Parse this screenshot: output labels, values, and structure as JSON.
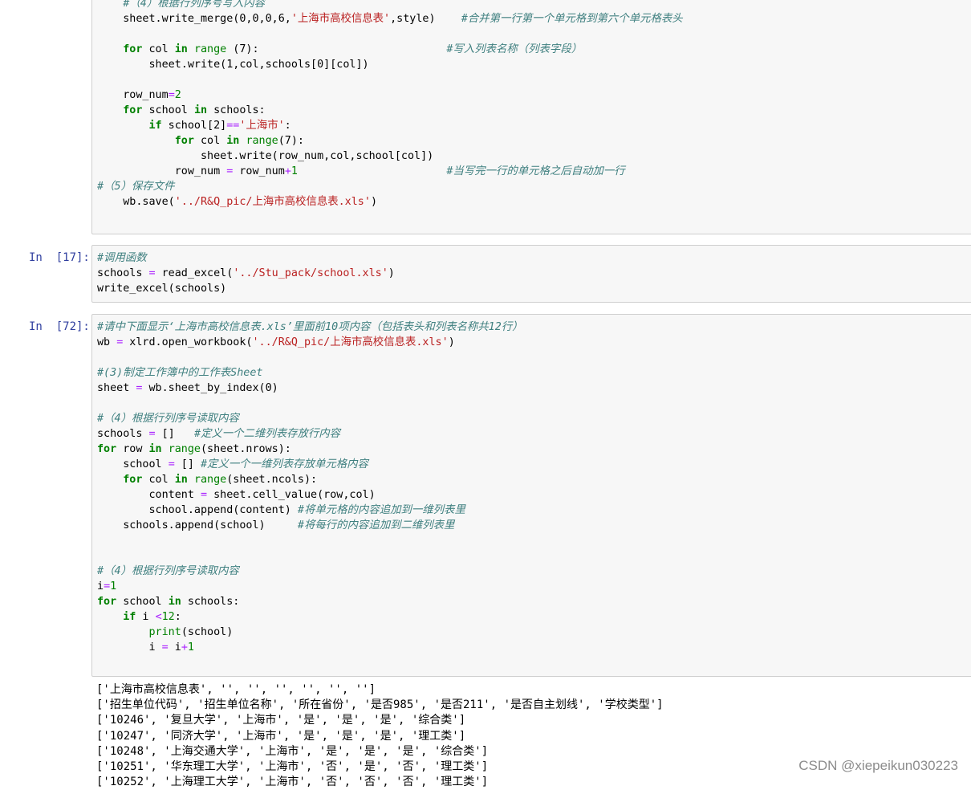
{
  "cells": [
    {
      "prompt": "",
      "lines": [
        [
          {
            "t": "    "
          },
          {
            "t": "#（4）根据行列序号写入内容",
            "c": "cm"
          }
        ],
        [
          {
            "t": "    sheet.write_merge(0,0,0,6,"
          },
          {
            "t": "'上海市高校信息表'",
            "c": "str"
          },
          {
            "t": ",style)    "
          },
          {
            "t": "#合并第一行第一个单元格到第六个单元格表头",
            "c": "cm"
          }
        ],
        [
          {
            "t": ""
          }
        ],
        [
          {
            "t": "    "
          },
          {
            "t": "for",
            "c": "kw"
          },
          {
            "t": " col "
          },
          {
            "t": "in",
            "c": "kw"
          },
          {
            "t": " "
          },
          {
            "t": "range",
            "c": "bi"
          },
          {
            "t": " (7):                             "
          },
          {
            "t": "#写入列表名称（列表字段）",
            "c": "cm"
          }
        ],
        [
          {
            "t": "        sheet.write(1,col,schools[0][col])"
          }
        ],
        [
          {
            "t": ""
          }
        ],
        [
          {
            "t": "    row_num"
          },
          {
            "t": "=",
            "c": "op"
          },
          {
            "t": "2",
            "c": "num"
          }
        ],
        [
          {
            "t": "    "
          },
          {
            "t": "for",
            "c": "kw"
          },
          {
            "t": " school "
          },
          {
            "t": "in",
            "c": "kw"
          },
          {
            "t": " schools:"
          }
        ],
        [
          {
            "t": "        "
          },
          {
            "t": "if",
            "c": "kw"
          },
          {
            "t": " school[2]"
          },
          {
            "t": "==",
            "c": "op"
          },
          {
            "t": "'上海市'",
            "c": "str"
          },
          {
            "t": ":"
          }
        ],
        [
          {
            "t": "            "
          },
          {
            "t": "for",
            "c": "kw"
          },
          {
            "t": " col "
          },
          {
            "t": "in",
            "c": "kw"
          },
          {
            "t": " "
          },
          {
            "t": "range",
            "c": "bi"
          },
          {
            "t": "(7):"
          }
        ],
        [
          {
            "t": "                sheet.write(row_num,col,school[col])"
          }
        ],
        [
          {
            "t": "            row_num "
          },
          {
            "t": "=",
            "c": "op"
          },
          {
            "t": " row_num"
          },
          {
            "t": "+",
            "c": "op"
          },
          {
            "t": "1",
            "c": "num"
          },
          {
            "t": "                       "
          },
          {
            "t": "#当写完一行的单元格之后自动加一行",
            "c": "cm"
          }
        ],
        [
          {
            "t": "#（5）保存文件",
            "c": "cm"
          }
        ],
        [
          {
            "t": "    wb.save("
          },
          {
            "t": "'../R&Q_pic/上海市高校信息表.xls'",
            "c": "str"
          },
          {
            "t": ")"
          }
        ]
      ]
    },
    {
      "prompt": "In  [17]:",
      "lines": [
        [
          {
            "t": "#调用函数",
            "c": "cm"
          }
        ],
        [
          {
            "t": "schools "
          },
          {
            "t": "=",
            "c": "op"
          },
          {
            "t": " read_excel("
          },
          {
            "t": "'../Stu_pack/school.xls'",
            "c": "str"
          },
          {
            "t": ")"
          }
        ],
        [
          {
            "t": "write_excel(schools)"
          }
        ]
      ]
    },
    {
      "prompt": "In  [72]:",
      "lines": [
        [
          {
            "t": "#请中下面显示‘上海市高校信息表.xls’里面前10项内容（包括表头和列表名称共12行）",
            "c": "cm"
          }
        ],
        [
          {
            "t": "wb "
          },
          {
            "t": "=",
            "c": "op"
          },
          {
            "t": " xlrd.open_workbook("
          },
          {
            "t": "'../R&Q_pic/上海市高校信息表.xls'",
            "c": "str"
          },
          {
            "t": ")"
          }
        ],
        [
          {
            "t": ""
          }
        ],
        [
          {
            "t": "#(3)制定工作簿中的工作表Sheet",
            "c": "cm"
          }
        ],
        [
          {
            "t": "sheet "
          },
          {
            "t": "=",
            "c": "op"
          },
          {
            "t": " wb.sheet_by_index(0)"
          }
        ],
        [
          {
            "t": ""
          }
        ],
        [
          {
            "t": "#（4）根据行列序号读取内容",
            "c": "cm"
          }
        ],
        [
          {
            "t": "schools "
          },
          {
            "t": "=",
            "c": "op"
          },
          {
            "t": " []   "
          },
          {
            "t": "#定义一个二维列表存放行内容",
            "c": "cm"
          }
        ],
        [
          {
            "t": "for",
            "c": "kw"
          },
          {
            "t": " row "
          },
          {
            "t": "in",
            "c": "kw"
          },
          {
            "t": " "
          },
          {
            "t": "range",
            "c": "bi"
          },
          {
            "t": "(sheet.nrows):"
          }
        ],
        [
          {
            "t": "    school "
          },
          {
            "t": "=",
            "c": "op"
          },
          {
            "t": " [] "
          },
          {
            "t": "#定义一个一维列表存放单元格内容",
            "c": "cm"
          }
        ],
        [
          {
            "t": "    "
          },
          {
            "t": "for",
            "c": "kw"
          },
          {
            "t": " col "
          },
          {
            "t": "in",
            "c": "kw"
          },
          {
            "t": " "
          },
          {
            "t": "range",
            "c": "bi"
          },
          {
            "t": "(sheet.ncols):"
          }
        ],
        [
          {
            "t": "        content "
          },
          {
            "t": "=",
            "c": "op"
          },
          {
            "t": " sheet.cell_value(row,col)"
          }
        ],
        [
          {
            "t": "        school.append(content) "
          },
          {
            "t": "#将单元格的内容追加到一维列表里",
            "c": "cm"
          }
        ],
        [
          {
            "t": "    schools.append(school)     "
          },
          {
            "t": "#将每行的内容追加到二维列表里",
            "c": "cm"
          }
        ],
        [
          {
            "t": ""
          }
        ],
        [
          {
            "t": ""
          }
        ],
        [
          {
            "t": "#（4）根据行列序号读取内容",
            "c": "cm"
          }
        ],
        [
          {
            "t": "i"
          },
          {
            "t": "=",
            "c": "op"
          },
          {
            "t": "1",
            "c": "num"
          }
        ],
        [
          {
            "t": "for",
            "c": "kw"
          },
          {
            "t": " school "
          },
          {
            "t": "in",
            "c": "kw"
          },
          {
            "t": " schools:"
          }
        ],
        [
          {
            "t": "    "
          },
          {
            "t": "if",
            "c": "kw"
          },
          {
            "t": " i "
          },
          {
            "t": "<",
            "c": "op"
          },
          {
            "t": "12",
            "c": "num"
          },
          {
            "t": ":"
          }
        ],
        [
          {
            "t": "        "
          },
          {
            "t": "print",
            "c": "bi"
          },
          {
            "t": "(school)"
          }
        ],
        [
          {
            "t": "        i "
          },
          {
            "t": "=",
            "c": "op"
          },
          {
            "t": " i"
          },
          {
            "t": "+",
            "c": "op"
          },
          {
            "t": "1",
            "c": "num"
          }
        ]
      ]
    }
  ],
  "output": [
    "['上海市高校信息表', '', '', '', '', '', '']",
    "['招生单位代码', '招生单位名称', '所在省份', '是否985', '是否211', '是否自主划线', '学校类型']",
    "['10246', '复旦大学', '上海市', '是', '是', '是', '综合类']",
    "['10247', '同济大学', '上海市', '是', '是', '是', '理工类']",
    "['10248', '上海交通大学', '上海市', '是', '是', '是', '综合类']",
    "['10251', '华东理工大学', '上海市', '否', '是', '否', '理工类']",
    "['10252', '上海理工大学', '上海市', '否', '否', '否', '理工类']"
  ],
  "watermark": "CSDN @xiepeikun030223"
}
